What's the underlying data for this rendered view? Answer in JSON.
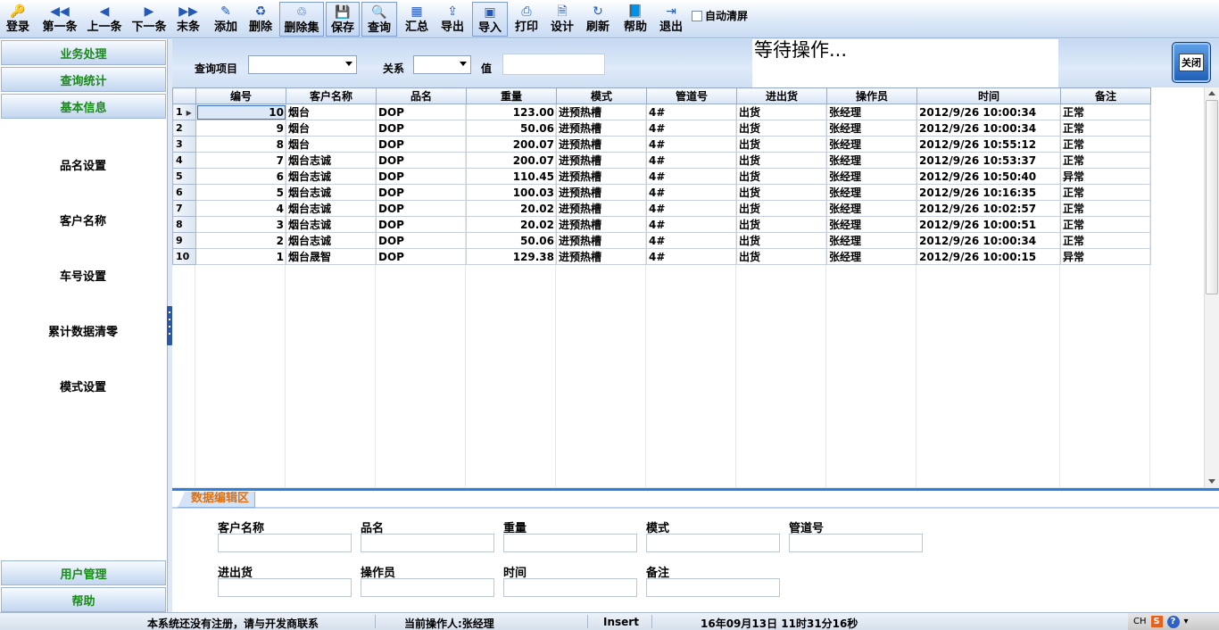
{
  "toolbar": {
    "buttons": [
      {
        "label": "登录",
        "icon": "🔑"
      },
      {
        "label": "第一条",
        "icon": "◀◀"
      },
      {
        "label": "上一条",
        "icon": "◀"
      },
      {
        "label": "下一条",
        "icon": "▶"
      },
      {
        "label": "末条",
        "icon": "▶▶"
      },
      {
        "label": "添加",
        "icon": "✎"
      },
      {
        "label": "删除",
        "icon": "♻"
      },
      {
        "label": "删除集",
        "icon": "♲"
      },
      {
        "label": "保存",
        "icon": "💾"
      },
      {
        "label": "查询",
        "icon": "🔍"
      },
      {
        "label": "汇总",
        "icon": "▦"
      },
      {
        "label": "导出",
        "icon": "⇪"
      },
      {
        "label": "导入",
        "icon": "▣"
      },
      {
        "label": "打印",
        "icon": "⎙"
      },
      {
        "label": "设计",
        "icon": "🗎"
      },
      {
        "label": "刷新",
        "icon": "↻"
      },
      {
        "label": "帮助",
        "icon": "📘"
      },
      {
        "label": "退出",
        "icon": "⇥"
      }
    ],
    "auto_clear_label": "自动清屏",
    "auto_clear_checked": false
  },
  "sidebar": {
    "top_headers": [
      "业务处理",
      "查询统计",
      "基本信息"
    ],
    "items": [
      "品名设置",
      "客户名称",
      "车号设置",
      "累计数据清零",
      "模式设置"
    ],
    "bottom_headers": [
      "用户管理",
      "帮助"
    ]
  },
  "query": {
    "item_label": "查询项目",
    "item_value": "",
    "relation_label": "关系",
    "relation_value": "",
    "value_label": "值",
    "value_value": ""
  },
  "status_message": "等待操作...",
  "close_label": "关闭",
  "grid": {
    "columns": [
      "编号",
      "客户名称",
      "品名",
      "重量",
      "模式",
      "管道号",
      "进出货",
      "操作员",
      "时间",
      "备注"
    ],
    "rows": [
      [
        "10",
        "烟台",
        "DOP",
        "123.00",
        "进预热槽",
        "4#",
        "出货",
        "张经理",
        "2012/9/26 10:00:34",
        "正常"
      ],
      [
        "9",
        "烟台",
        "DOP",
        "50.06",
        "进预热槽",
        "4#",
        "出货",
        "张经理",
        "2012/9/26 10:00:34",
        "正常"
      ],
      [
        "8",
        "烟台",
        "DOP",
        "200.07",
        "进预热槽",
        "4#",
        "出货",
        "张经理",
        "2012/9/26 10:55:12",
        "正常"
      ],
      [
        "7",
        "烟台志诚",
        "DOP",
        "200.07",
        "进预热槽",
        "4#",
        "出货",
        "张经理",
        "2012/9/26 10:53:37",
        "正常"
      ],
      [
        "6",
        "烟台志诚",
        "DOP",
        "110.45",
        "进预热槽",
        "4#",
        "出货",
        "张经理",
        "2012/9/26 10:50:40",
        "异常"
      ],
      [
        "5",
        "烟台志诚",
        "DOP",
        "100.03",
        "进预热槽",
        "4#",
        "出货",
        "张经理",
        "2012/9/26 10:16:35",
        "正常"
      ],
      [
        "4",
        "烟台志诚",
        "DOP",
        "20.02",
        "进预热槽",
        "4#",
        "出货",
        "张经理",
        "2012/9/26 10:02:57",
        "正常"
      ],
      [
        "3",
        "烟台志诚",
        "DOP",
        "20.02",
        "进预热槽",
        "4#",
        "出货",
        "张经理",
        "2012/9/26 10:00:51",
        "正常"
      ],
      [
        "2",
        "烟台志诚",
        "DOP",
        "50.06",
        "进预热槽",
        "4#",
        "出货",
        "张经理",
        "2012/9/26 10:00:34",
        "正常"
      ],
      [
        "1",
        "烟台晟智",
        "DOP",
        "129.38",
        "进预热槽",
        "4#",
        "出货",
        "张经理",
        "2012/9/26 10:00:15",
        "异常"
      ]
    ],
    "row_headers": [
      "1",
      "2",
      "3",
      "4",
      "5",
      "6",
      "7",
      "8",
      "9",
      "10"
    ],
    "current_row_marker": "▶"
  },
  "edit_panel": {
    "tab_label": "数据编辑区",
    "fields_row1": [
      {
        "label": "客户名称",
        "value": ""
      },
      {
        "label": "品名",
        "value": ""
      },
      {
        "label": "重量",
        "value": ""
      },
      {
        "label": "模式",
        "value": ""
      },
      {
        "label": "管道号",
        "value": ""
      }
    ],
    "fields_row2": [
      {
        "label": "进出货",
        "value": ""
      },
      {
        "label": "操作员",
        "value": ""
      },
      {
        "label": "时间",
        "value": ""
      },
      {
        "label": "备注",
        "value": ""
      }
    ]
  },
  "statusbar": {
    "registration": "本系统还没有注册，请与开发商联系",
    "operator": "当前操作人:张经理",
    "mode": "Insert",
    "datetime": "16年09月13日  11时31分16秒",
    "ime": "CH"
  }
}
